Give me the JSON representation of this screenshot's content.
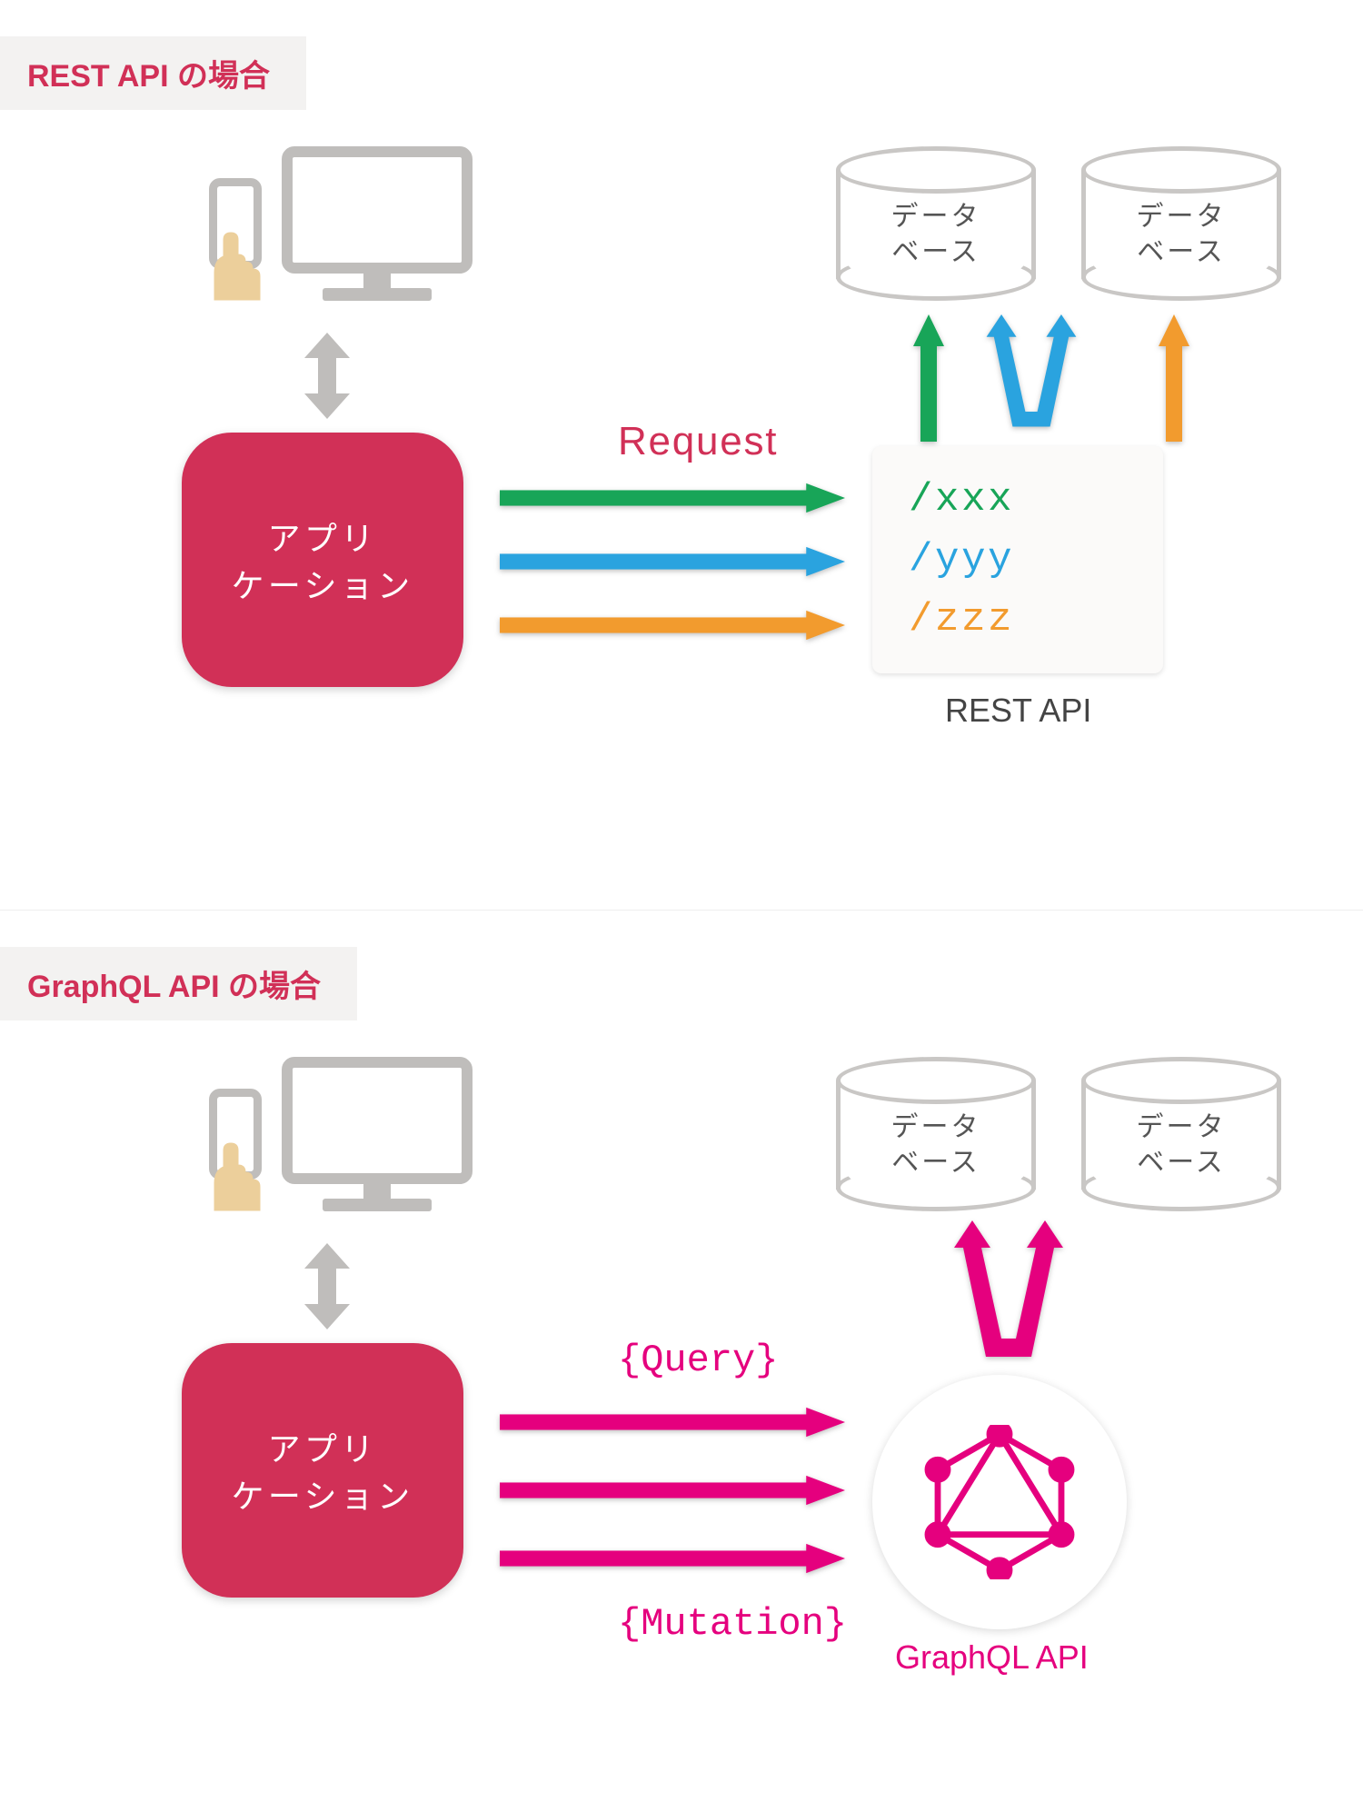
{
  "colors": {
    "crimson": "#d13057",
    "magenta": "#e5007e",
    "green": "#18a558",
    "blue": "#2aa3df",
    "orange": "#f29b2e",
    "grey": "#bfbdbb",
    "text": "#555555",
    "hand": "#eccf9b"
  },
  "rest": {
    "title": "REST API の場合",
    "app_line1": "アプリ",
    "app_line2": "ケーション",
    "request_label": "Request",
    "caption": "REST API",
    "endpoints": {
      "xxx": "/xxx",
      "yyy": "/yyy",
      "zzz": "/zzz"
    },
    "db_label_1": "データ",
    "db_label_2": "ベース"
  },
  "graphql": {
    "title": "GraphQL API の場合",
    "app_line1": "アプリ",
    "app_line2": "ケーション",
    "query_label": "{Query}",
    "mutation_label": "{Mutation}",
    "caption": "GraphQL API",
    "db_label_1": "データ",
    "db_label_2": "ベース"
  }
}
